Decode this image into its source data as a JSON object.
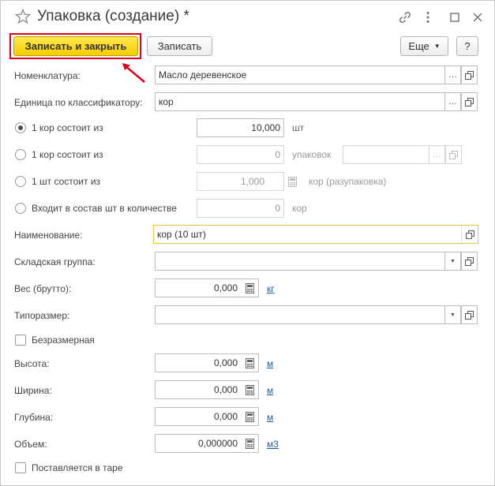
{
  "window": {
    "title": "Упаковка (создание) *"
  },
  "toolbar": {
    "save_close_label": "Записать и закрыть",
    "save_label": "Записать",
    "more_label": "Еще",
    "help_label": "?"
  },
  "form": {
    "nomenclature": {
      "label": "Номенклатура:",
      "value": "Масло деревенское"
    },
    "classifier_unit": {
      "label": "Единица по классификатору:",
      "value": "кор"
    },
    "options": [
      {
        "label": "1 кор состоит из",
        "value": "10,000",
        "suffix": "шт",
        "checked": true
      },
      {
        "label": "1 кор состоит из",
        "value": "0",
        "suffix": "упаковок",
        "checked": false
      },
      {
        "label": "1 шт состоит из",
        "value": "1,000",
        "suffix": "кор (разупаковка)",
        "checked": false
      },
      {
        "label": "Входит в состав шт в количестве",
        "value": "0",
        "suffix": "кор",
        "checked": false
      }
    ],
    "name": {
      "label": "Наименование:",
      "value": "кор (10 шт)"
    },
    "warehouse_group": {
      "label": "Складская группа:",
      "value": ""
    },
    "weight": {
      "label": "Вес (брутто):",
      "value": "0,000",
      "unit": "кг"
    },
    "size_type": {
      "label": "Типоразмер:",
      "value": ""
    },
    "dimensionless": {
      "label": "Безразмерная",
      "checked": false
    },
    "height": {
      "label": "Высота:",
      "value": "0,000",
      "unit": "м"
    },
    "width": {
      "label": "Ширина:",
      "value": "0,000",
      "unit": "м"
    },
    "depth": {
      "label": "Глубина:",
      "value": "0,000",
      "unit": "м"
    },
    "volume": {
      "label": "Объем:",
      "value": "0,000000",
      "unit": "м3"
    },
    "in_container": {
      "label": "Поставляется в таре",
      "checked": false
    }
  },
  "colors": {
    "accent_highlight": "#e0001b",
    "primary_button": "#f6cd00",
    "link": "#1a5ea8"
  }
}
